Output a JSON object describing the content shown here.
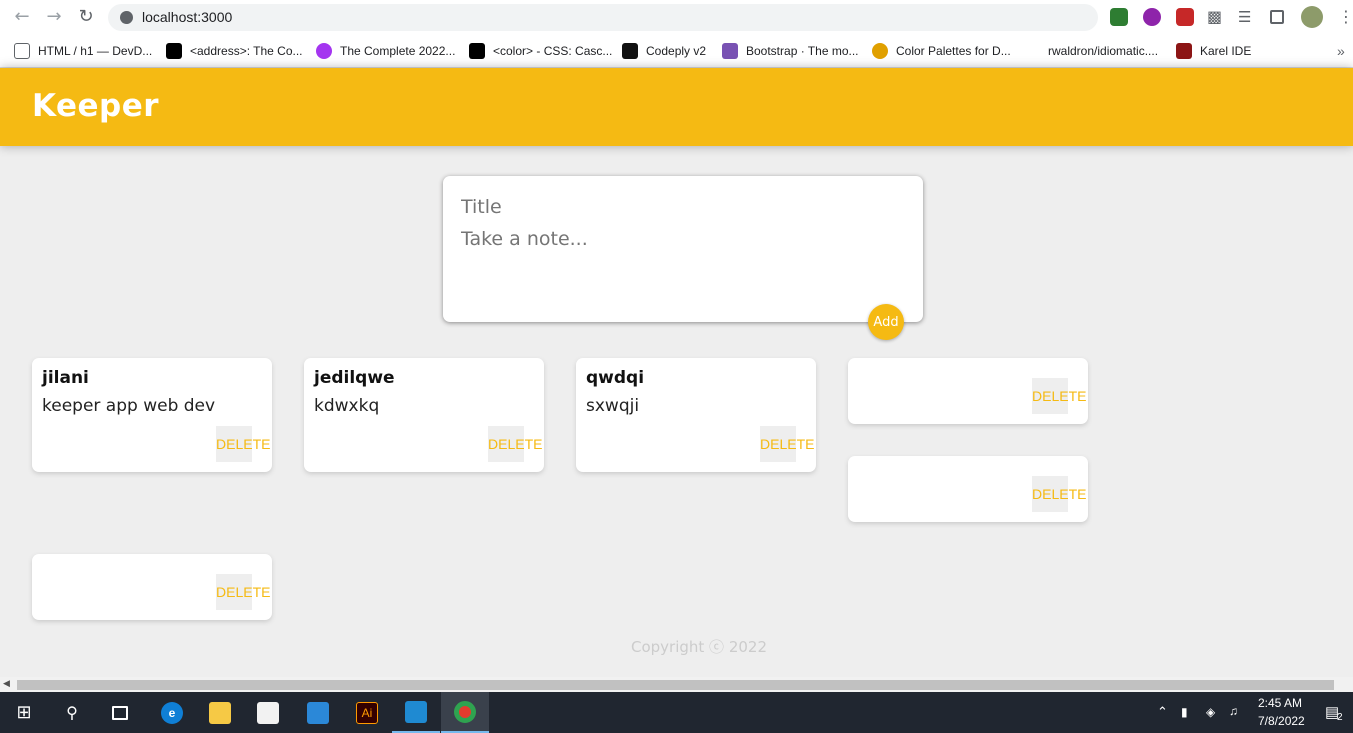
{
  "browser": {
    "url": "localhost:3000",
    "bookmarks": [
      {
        "label": "HTML / h1 — DevD...",
        "icon": "search-page-icon",
        "color": "#5f6368"
      },
      {
        "label": "<address>: The Co...",
        "icon": "mdn-icon",
        "color": "#000000"
      },
      {
        "label": "The Complete 2022...",
        "icon": "udemy-icon",
        "color": "#a435f0"
      },
      {
        "label": "<color> - CSS: Casc...",
        "icon": "mdn-icon",
        "color": "#000000"
      },
      {
        "label": "Codeply v2",
        "icon": "codeply-icon",
        "color": "#111111"
      },
      {
        "label": "Bootstrap · The mo...",
        "icon": "bootstrap-icon",
        "color": "#7952b3"
      },
      {
        "label": "Color Palettes for D...",
        "icon": "palette-icon",
        "color": "#e0a000"
      },
      {
        "label": "rwaldron/idiomatic....",
        "icon": "none",
        "color": "#ffffff"
      },
      {
        "label": "Karel IDE",
        "icon": "stanford-icon",
        "color": "#8c1515"
      }
    ]
  },
  "app": {
    "title": "Keeper",
    "accent": "#f5ba13",
    "create": {
      "title_placeholder": "Title",
      "content_placeholder": "Take a note...",
      "add_label": "Add"
    },
    "notes": [
      {
        "title": "jilani",
        "content": "keeper app web dev",
        "delete_label": "DELETE"
      },
      {
        "title": "jedilqwe",
        "content": "kdwxkq",
        "delete_label": "DELETE"
      },
      {
        "title": "qwdqi",
        "content": "sxwqji",
        "delete_label": "DELETE"
      },
      {
        "title": "",
        "content": "",
        "delete_label": "DELETE"
      },
      {
        "title": "",
        "content": "",
        "delete_label": "DELETE"
      },
      {
        "title": "",
        "content": "",
        "delete_label": "DELETE"
      }
    ],
    "footer": "Copyright ⓒ 2022"
  },
  "taskbar": {
    "time": "2:45 AM",
    "date": "7/8/2022",
    "notification_count": "2",
    "apps": [
      "start-icon",
      "search-icon",
      "task-view-icon",
      "edge-icon",
      "file-explorer-icon",
      "store-icon",
      "mail-icon",
      "illustrator-icon",
      "vscode-icon",
      "chrome-icon"
    ]
  }
}
